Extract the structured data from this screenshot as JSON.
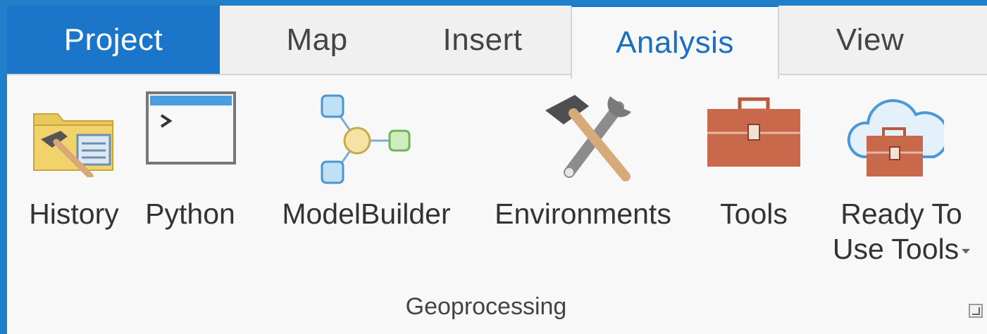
{
  "tabs": [
    {
      "label": "Project"
    },
    {
      "label": "Map"
    },
    {
      "label": "Insert"
    },
    {
      "label": "Analysis"
    },
    {
      "label": "View"
    }
  ],
  "ribbon": {
    "group_label": "Geoprocessing",
    "tools": [
      {
        "label": "History",
        "icon": "history-folder-hammer-icon"
      },
      {
        "label": "Python",
        "icon": "python-window-icon"
      },
      {
        "label": "ModelBuilder",
        "icon": "modelbuilder-icon"
      },
      {
        "label": "Environments",
        "icon": "hammer-wrench-icon"
      },
      {
        "label": "Tools",
        "icon": "toolbox-icon"
      },
      {
        "label_line1": "Ready To",
        "label_line2": "Use Tools",
        "icon": "cloud-toolbox-icon"
      }
    ]
  },
  "colors": {
    "accent": "#1b76c9",
    "active_tab_text": "#1b6fc0",
    "ribbon_bg": "#f8f8f8",
    "toolbox": "#c9694b"
  }
}
